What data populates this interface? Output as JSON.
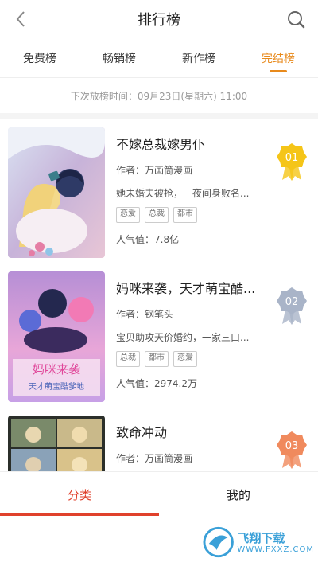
{
  "header": {
    "title": "排行榜"
  },
  "tabs": [
    {
      "label": "免费榜"
    },
    {
      "label": "畅销榜"
    },
    {
      "label": "新作榜"
    },
    {
      "label": "完结榜"
    }
  ],
  "release_time": "下次放榜时间：09月23日(星期六) 11:00",
  "items": [
    {
      "rank": "01",
      "title": "不嫁总裁嫁男仆",
      "author": "作者：万画筒漫画",
      "desc": "她未婚夫被抢，一夜间身败名...",
      "tags": [
        "恋爱",
        "总裁",
        "都市"
      ],
      "popularity": "人气值：7.8亿",
      "medal_color": "#f5c518"
    },
    {
      "rank": "02",
      "title": "妈咪来袭，天才萌宝酷...",
      "author": "作者：钢笔头",
      "desc": "宝贝助攻天价婚约，一家三口...",
      "tags": [
        "总裁",
        "都市",
        "恋爱"
      ],
      "popularity": "人气值：2974.2万",
      "medal_color": "#a9b4c8",
      "cover_text": "妈咪来袭",
      "cover_subtext": "天才萌宝酷爹地"
    },
    {
      "rank": "03",
      "title": "致命冲动",
      "author": "作者：万画筒漫画",
      "medal_color": "#f08a5d"
    }
  ],
  "bottom_nav": [
    {
      "label": "分类"
    },
    {
      "label": "我的"
    }
  ],
  "watermark": {
    "text": "飞翔下载",
    "url": "WWW.FXXZ.COM"
  },
  "colors": {
    "accent": "#e88a1c",
    "bottom_active": "#e0412c"
  }
}
